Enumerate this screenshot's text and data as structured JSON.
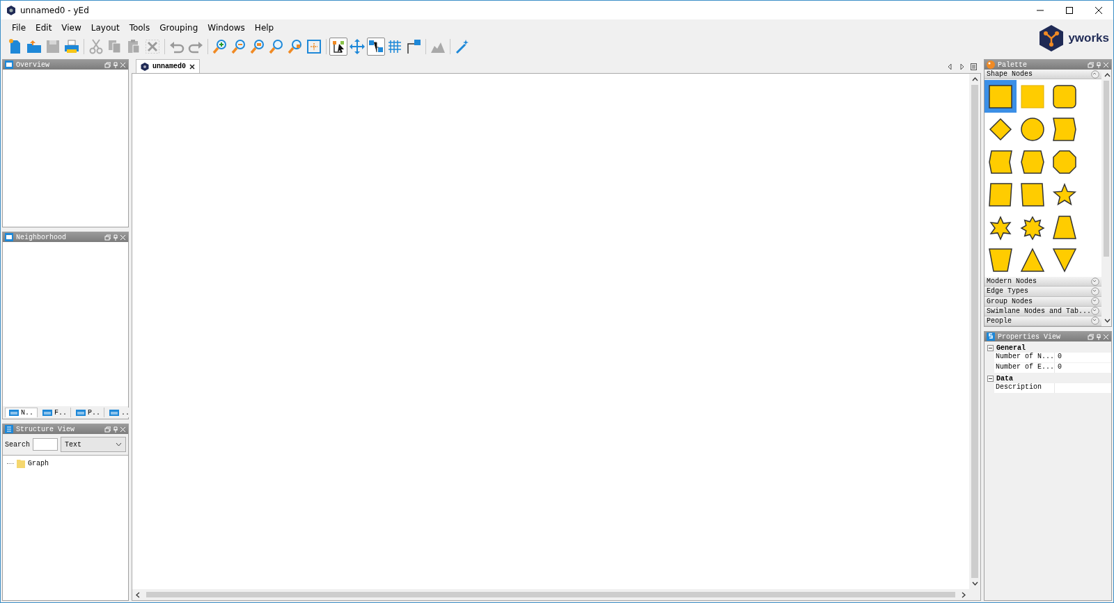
{
  "window": {
    "title": "unnamed0 - yEd"
  },
  "menu": [
    "File",
    "Edit",
    "View",
    "Layout",
    "Tools",
    "Grouping",
    "Windows",
    "Help"
  ],
  "toolbar": [
    {
      "kind": "new",
      "disabled": false,
      "selected": false
    },
    {
      "kind": "open",
      "disabled": false,
      "selected": false
    },
    {
      "kind": "save",
      "disabled": true,
      "selected": false
    },
    {
      "kind": "print",
      "disabled": false,
      "selected": false
    },
    {
      "kind": "separator"
    },
    {
      "kind": "cut",
      "disabled": true,
      "selected": false
    },
    {
      "kind": "copy",
      "disabled": true,
      "selected": false
    },
    {
      "kind": "paste",
      "disabled": true,
      "selected": false
    },
    {
      "kind": "delete",
      "disabled": true,
      "selected": false
    },
    {
      "kind": "separator"
    },
    {
      "kind": "undo",
      "disabled": true,
      "selected": false
    },
    {
      "kind": "redo",
      "disabled": true,
      "selected": false
    },
    {
      "kind": "separator"
    },
    {
      "kind": "zoom-in",
      "disabled": false,
      "selected": false
    },
    {
      "kind": "zoom-out",
      "disabled": false,
      "selected": false
    },
    {
      "kind": "zoom-actual",
      "disabled": false,
      "selected": false
    },
    {
      "kind": "zoom",
      "disabled": false,
      "selected": false
    },
    {
      "kind": "zoom-selection",
      "disabled": false,
      "selected": false
    },
    {
      "kind": "fit",
      "disabled": false,
      "selected": false
    },
    {
      "kind": "separator"
    },
    {
      "kind": "edit",
      "disabled": false,
      "selected": true
    },
    {
      "kind": "move",
      "disabled": false,
      "selected": false
    },
    {
      "kind": "nodes",
      "disabled": false,
      "selected": true
    },
    {
      "kind": "grid",
      "disabled": false,
      "selected": false
    },
    {
      "kind": "edge",
      "disabled": false,
      "selected": false
    },
    {
      "kind": "separator"
    },
    {
      "kind": "layout",
      "disabled": true,
      "selected": false
    },
    {
      "kind": "separator"
    },
    {
      "kind": "wand",
      "disabled": false,
      "selected": false
    }
  ],
  "logo": {
    "text": "yworks"
  },
  "overview": {
    "title": "Overview"
  },
  "neighborhood": {
    "title": "Neighborhood",
    "tabs": [
      {
        "label": "N..",
        "selected": true
      },
      {
        "label": "F..",
        "selected": false
      },
      {
        "label": "P..",
        "selected": false
      },
      {
        "label": "..",
        "selected": false
      }
    ]
  },
  "structure": {
    "title": "Structure View",
    "search_label": "Search",
    "filter": "Text",
    "tree": [
      {
        "label": "Graph"
      }
    ]
  },
  "document_tabs": [
    {
      "label": "unnamed0",
      "selected": true
    }
  ],
  "palette": {
    "title": "Palette",
    "sections": [
      {
        "title": "Shape Nodes",
        "expanded": true,
        "shapes": [
          {
            "kind": "rectangle",
            "selected": true
          },
          {
            "kind": "flat-rectangle",
            "selected": false
          },
          {
            "kind": "rounded-rectangle",
            "selected": false
          },
          {
            "kind": "diamond",
            "selected": false
          },
          {
            "kind": "circle",
            "selected": false
          },
          {
            "kind": "arrow-right",
            "selected": false
          },
          {
            "kind": "arrow-left",
            "selected": false
          },
          {
            "kind": "hexagon",
            "selected": false
          },
          {
            "kind": "octagon",
            "selected": false
          },
          {
            "kind": "parallelogram",
            "selected": false
          },
          {
            "kind": "parallelogram-reverse",
            "selected": false
          },
          {
            "kind": "star5",
            "selected": false
          },
          {
            "kind": "star6",
            "selected": false
          },
          {
            "kind": "star8",
            "selected": false
          },
          {
            "kind": "trapezoid",
            "selected": false
          },
          {
            "kind": "trapezoid-inverted",
            "selected": false
          },
          {
            "kind": "triangle",
            "selected": false
          },
          {
            "kind": "triangle-down",
            "selected": false
          }
        ]
      },
      {
        "title": "Modern Nodes",
        "expanded": false
      },
      {
        "title": "Edge Types",
        "expanded": false
      },
      {
        "title": "Group Nodes",
        "expanded": false
      },
      {
        "title": "Swimlane Nodes and Tab...",
        "expanded": false
      },
      {
        "title": "People",
        "expanded": false
      }
    ]
  },
  "properties": {
    "title": "Properties View",
    "groups": [
      {
        "title": "General",
        "expanded": true,
        "rows": [
          {
            "name": "Number of N...",
            "value": "0"
          },
          {
            "name": "Number of E...",
            "value": "0"
          }
        ]
      },
      {
        "title": "Data",
        "expanded": true,
        "rows": [
          {
            "name": "Description"
          }
        ]
      }
    ]
  }
}
